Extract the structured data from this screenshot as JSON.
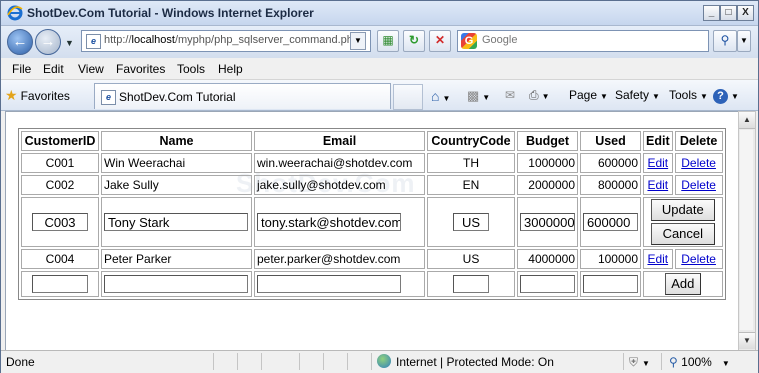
{
  "window": {
    "title": "ShotDev.Com Tutorial - Windows Internet Explorer",
    "min_label": "_",
    "max_label": "□",
    "close_label": "X"
  },
  "address": {
    "url_prefix": "http://",
    "url_host": "localhost",
    "url_path": "/myphp/php_sqlserver_command.ph",
    "search_placeholder": "Google"
  },
  "menu": [
    "File",
    "Edit",
    "View",
    "Favorites",
    "Tools",
    "Help"
  ],
  "toolbar": {
    "favorites_label": "Favorites",
    "tab_title": "ShotDev.Com Tutorial",
    "page_label": "Page",
    "safety_label": "Safety",
    "tools_label": "Tools"
  },
  "table": {
    "headers": [
      "CustomerID",
      "Name",
      "Email",
      "CountryCode",
      "Budget",
      "Used",
      "Edit",
      "Delete"
    ],
    "rows": [
      {
        "id": "C001",
        "name": "Win Weerachai",
        "email": "win.weerachai@shotdev.com",
        "country": "TH",
        "budget": "1000000",
        "used": "600000"
      },
      {
        "id": "C002",
        "name": "Jake Sully",
        "email": "jake.sully@shotdev.com",
        "country": "EN",
        "budget": "2000000",
        "used": "800000"
      },
      {
        "id": "C004",
        "name": "Peter Parker",
        "email": "peter.parker@shotdev.com",
        "country": "US",
        "budget": "4000000",
        "used": "100000"
      }
    ],
    "edit_row": {
      "id": "C003",
      "name": "Tony Stark",
      "email": "tony.stark@shotdev.com",
      "country": "US",
      "budget": "3000000",
      "used": "600000"
    },
    "edit_link": "Edit",
    "delete_link": "Delete",
    "update_label": "Update",
    "cancel_label": "Cancel",
    "add_label": "Add"
  },
  "status": {
    "left": "Done",
    "zone": "Internet | Protected Mode: On",
    "zoom": "100%"
  }
}
